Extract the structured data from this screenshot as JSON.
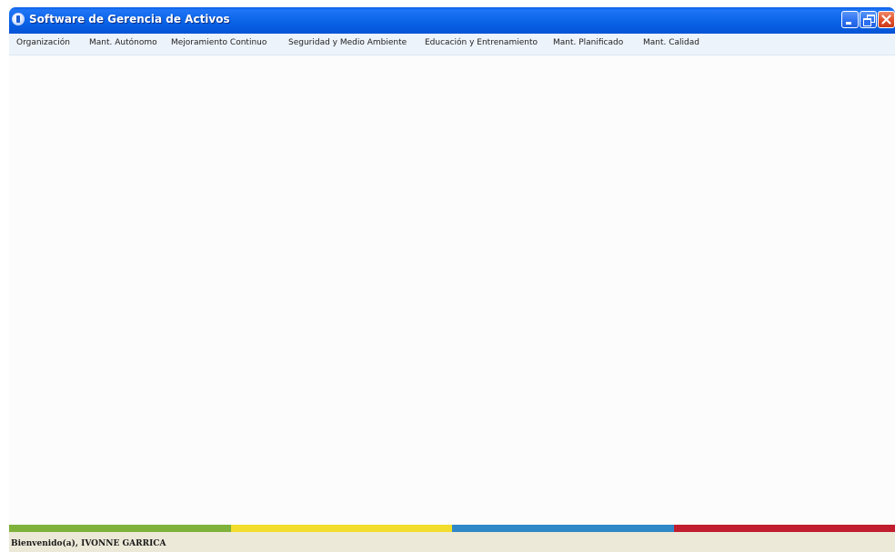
{
  "window": {
    "title": "Software de Gerencia de Activos",
    "icon": "app-logo-icon",
    "controls": {
      "minimize_icon": "minimize-icon",
      "restore_icon": "restore-icon",
      "close_icon": "close-icon"
    }
  },
  "menu": {
    "items": [
      {
        "label": "Organización"
      },
      {
        "label": "Mant. Autónomo"
      },
      {
        "label": "Mejoramiento Continuo"
      },
      {
        "label": "Seguridad y Medio Ambiente"
      },
      {
        "label": "Educación y Entrenamiento"
      },
      {
        "label": "Mant. Planificado"
      },
      {
        "label": "Mant. Calidad"
      }
    ]
  },
  "strip": {
    "colors": [
      "#7fb23a",
      "#f2dd2c",
      "#2f88c7",
      "#c01e2e"
    ]
  },
  "status": {
    "text": "Bienvenido(a), IVONNE GARRICA"
  },
  "colors": {
    "titlebar": "#0a5ee8",
    "menubar": "#edf3fb",
    "workspace": "#fcfcfd",
    "statusbar": "#ece9d8"
  }
}
